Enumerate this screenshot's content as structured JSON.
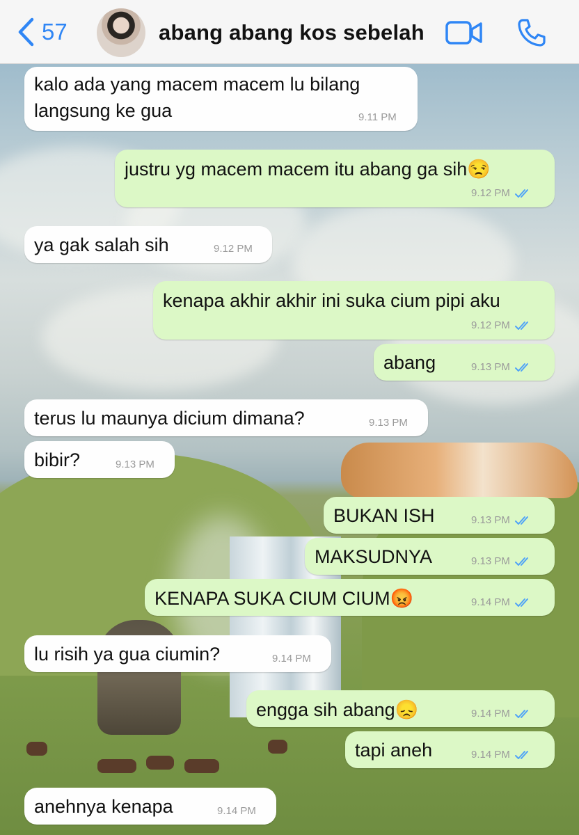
{
  "header": {
    "back_count": "57",
    "contact_name": "abang abang kos sebelah",
    "accent": "#2f86f5"
  },
  "messages": [
    {
      "dir": "in",
      "line1": "kalo ada yang macem macem lu bilang",
      "line2": "langsung ke gua",
      "time": "9.11 PM"
    },
    {
      "dir": "out",
      "text": "justru yg macem macem itu abang ga sih😒",
      "time": "9.12 PM"
    },
    {
      "dir": "in",
      "text": "ya gak salah sih",
      "time": "9.12 PM"
    },
    {
      "dir": "out",
      "text": "kenapa akhir akhir ini suka cium pipi aku",
      "time": "9.12 PM"
    },
    {
      "dir": "out",
      "text": "abang",
      "time": "9.13 PM"
    },
    {
      "dir": "in",
      "text": "terus lu maunya dicium dimana?",
      "time": "9.13 PM"
    },
    {
      "dir": "in",
      "text": "bibir?",
      "time": "9.13 PM"
    },
    {
      "dir": "out",
      "text": "BUKAN ISH",
      "time": "9.13 PM"
    },
    {
      "dir": "out",
      "text": "MAKSUDNYA",
      "time": "9.13 PM"
    },
    {
      "dir": "out",
      "text": "KENAPA SUKA CIUM CIUM😡",
      "time": "9.14 PM"
    },
    {
      "dir": "in",
      "text": "lu risih ya gua ciumin?",
      "time": "9.14 PM"
    },
    {
      "dir": "out",
      "text": "engga sih abang😞",
      "time": "9.14 PM"
    },
    {
      "dir": "out",
      "text": "tapi aneh",
      "time": "9.14 PM"
    },
    {
      "dir": "in",
      "text": "anehnya kenapa",
      "time": "9.14 PM"
    }
  ],
  "icons": {
    "back": "chevron-left-icon",
    "video": "video-camera-icon",
    "phone": "phone-icon",
    "read": "double-check-icon"
  }
}
